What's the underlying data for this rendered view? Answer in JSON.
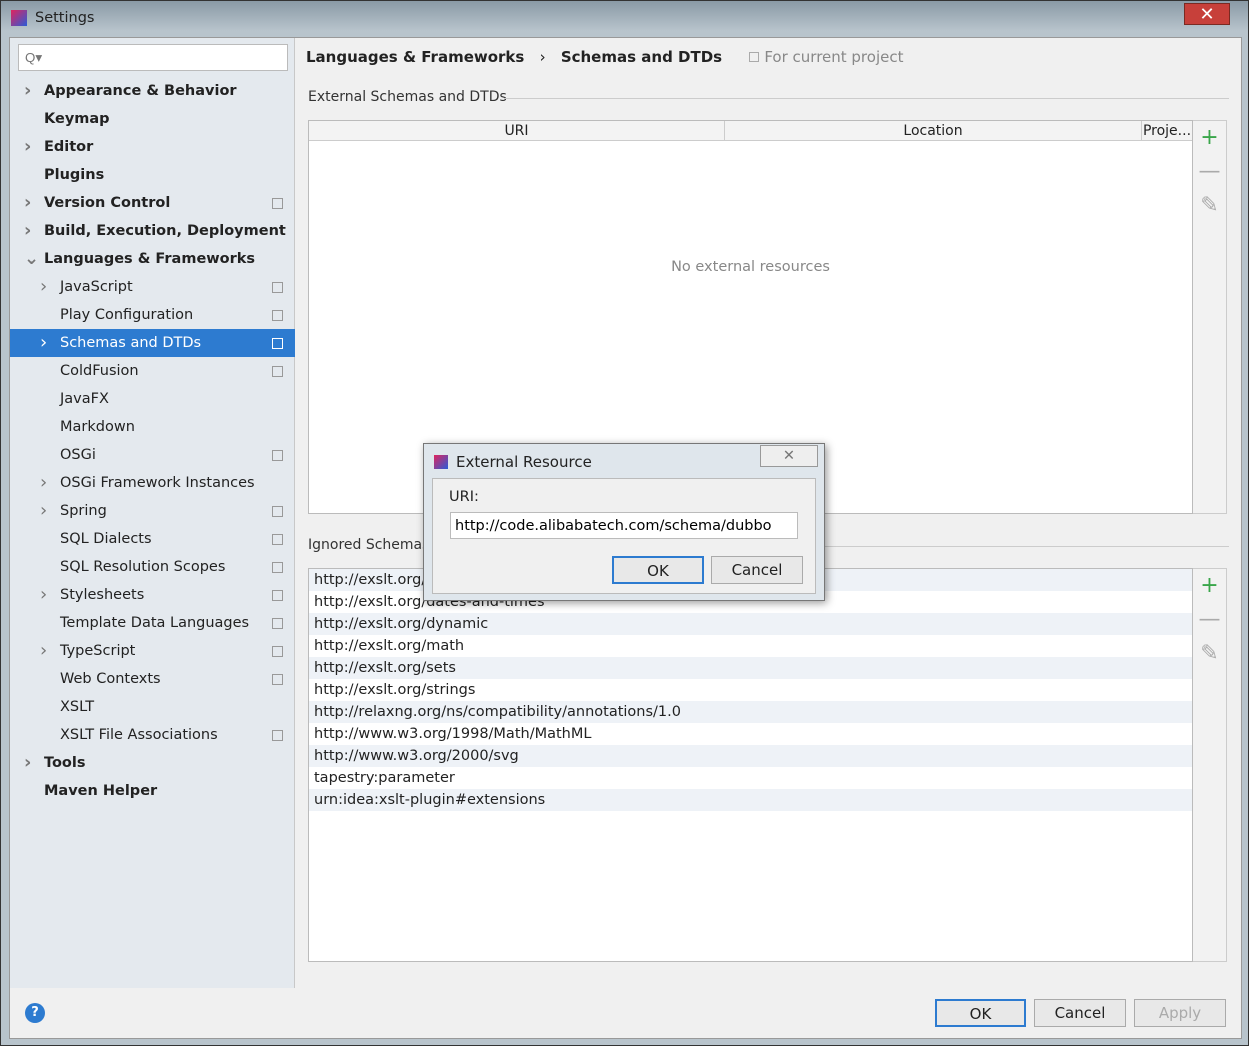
{
  "window": {
    "title": "Settings",
    "close": "✕"
  },
  "search": {
    "placeholder": "Q▾"
  },
  "tree": [
    {
      "label": "Appearance & Behavior",
      "level": 0,
      "bold": true,
      "chevron": "right",
      "copy": false
    },
    {
      "label": "Keymap",
      "level": 0,
      "bold": true,
      "chevron": "",
      "copy": false
    },
    {
      "label": "Editor",
      "level": 0,
      "bold": true,
      "chevron": "right",
      "copy": false
    },
    {
      "label": "Plugins",
      "level": 0,
      "bold": true,
      "chevron": "",
      "copy": false
    },
    {
      "label": "Version Control",
      "level": 0,
      "bold": true,
      "chevron": "right",
      "copy": true
    },
    {
      "label": "Build, Execution, Deployment",
      "level": 0,
      "bold": true,
      "chevron": "right",
      "copy": false
    },
    {
      "label": "Languages & Frameworks",
      "level": 0,
      "bold": true,
      "chevron": "down",
      "copy": false
    },
    {
      "label": "JavaScript",
      "level": 1,
      "chevron": "right",
      "copy": true
    },
    {
      "label": "Play Configuration",
      "level": 1,
      "chevron": "",
      "copy": true
    },
    {
      "label": "Schemas and DTDs",
      "level": 1,
      "chevron": "right",
      "copy": true,
      "selected": true
    },
    {
      "label": "ColdFusion",
      "level": 1,
      "chevron": "",
      "copy": true
    },
    {
      "label": "JavaFX",
      "level": 1,
      "chevron": "",
      "copy": false
    },
    {
      "label": "Markdown",
      "level": 1,
      "chevron": "",
      "copy": false
    },
    {
      "label": "OSGi",
      "level": 1,
      "chevron": "",
      "copy": true
    },
    {
      "label": "OSGi Framework Instances",
      "level": 1,
      "chevron": "right",
      "copy": false
    },
    {
      "label": "Spring",
      "level": 1,
      "chevron": "right",
      "copy": true
    },
    {
      "label": "SQL Dialects",
      "level": 1,
      "chevron": "",
      "copy": true
    },
    {
      "label": "SQL Resolution Scopes",
      "level": 1,
      "chevron": "",
      "copy": true
    },
    {
      "label": "Stylesheets",
      "level": 1,
      "chevron": "right",
      "copy": true
    },
    {
      "label": "Template Data Languages",
      "level": 1,
      "chevron": "",
      "copy": true
    },
    {
      "label": "TypeScript",
      "level": 1,
      "chevron": "right",
      "copy": true
    },
    {
      "label": "Web Contexts",
      "level": 1,
      "chevron": "",
      "copy": true
    },
    {
      "label": "XSLT",
      "level": 1,
      "chevron": "",
      "copy": false
    },
    {
      "label": "XSLT File Associations",
      "level": 1,
      "chevron": "",
      "copy": true
    },
    {
      "label": "Tools",
      "level": 0,
      "bold": true,
      "chevron": "right",
      "copy": false
    },
    {
      "label": "Maven Helper",
      "level": 0,
      "bold": true,
      "chevron": "",
      "copy": false
    }
  ],
  "breadcrumb": {
    "parent": "Languages & Frameworks",
    "sep": "›",
    "current": "Schemas and DTDs",
    "scope": "For current project"
  },
  "external": {
    "title": "External Schemas and DTDs",
    "columns": [
      "URI",
      "Location",
      "Proje..."
    ],
    "empty": "No external resources"
  },
  "ignored": {
    "title": "Ignored Schemas",
    "rows": [
      "http://exslt.org/common",
      "http://exslt.org/dates-and-times",
      "http://exslt.org/dynamic",
      "http://exslt.org/math",
      "http://exslt.org/sets",
      "http://exslt.org/strings",
      "http://relaxng.org/ns/compatibility/annotations/1.0",
      "http://www.w3.org/1998/Math/MathML",
      "http://www.w3.org/2000/svg",
      "tapestry:parameter",
      "urn:idea:xslt-plugin#extensions"
    ]
  },
  "toolbar": {
    "add": "+",
    "remove": "—",
    "edit": "✎"
  },
  "dialog": {
    "title": "External Resource",
    "close": "✕",
    "uri_label": "URI:",
    "uri_value": "http://code.alibabatech.com/schema/dubbo",
    "ok": "OK",
    "cancel": "Cancel"
  },
  "footer": {
    "help": "?",
    "ok": "OK",
    "cancel": "Cancel",
    "apply": "Apply"
  }
}
